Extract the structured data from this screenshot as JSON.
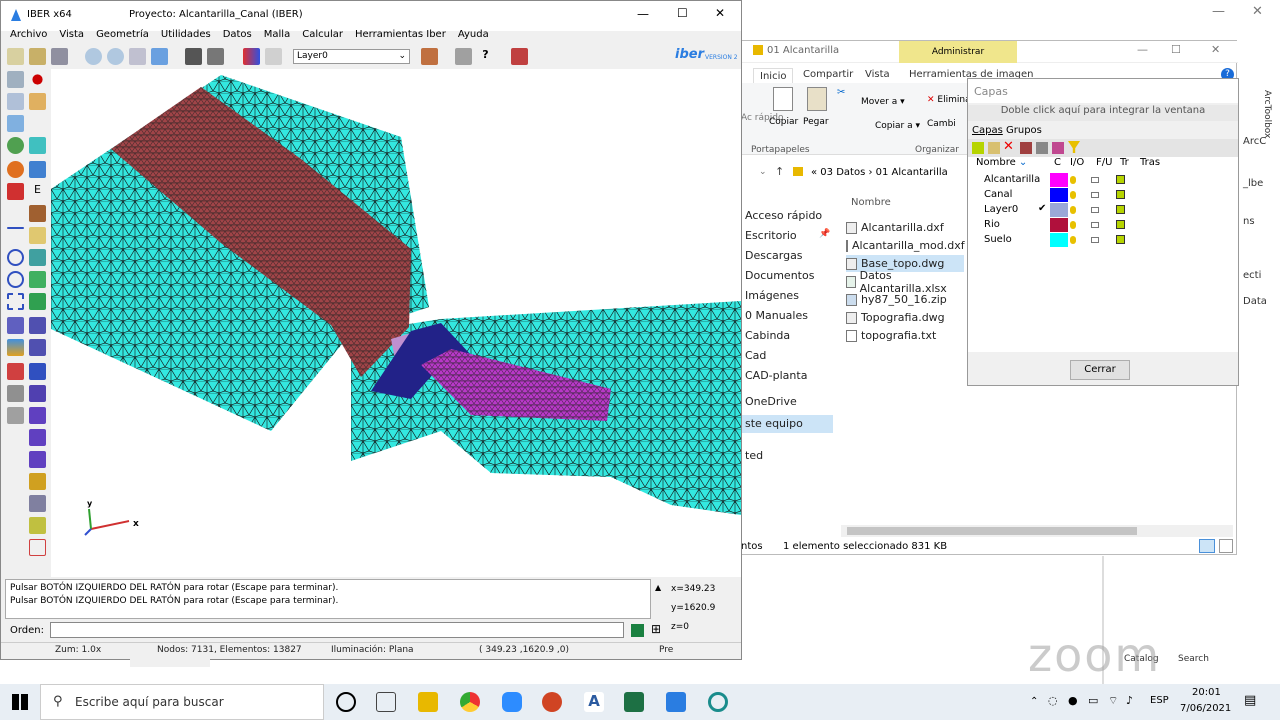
{
  "iber": {
    "title": "IBER x64",
    "project": "Proyecto: Alcantarilla_Canal (IBER)",
    "menu": [
      "Archivo",
      "Vista",
      "Geometría",
      "Utilidades",
      "Datos",
      "Malla",
      "Calcular",
      "Herramientas Iber",
      "Ayuda"
    ],
    "layer_select": "Layer0",
    "brand": "iber",
    "brand_sub": "VERSION 2",
    "console": [
      "Pulsar BOTÓN IZQUIERDO DEL RATÓN para rotar (Escape para terminar).",
      "Pulsar BOTÓN IZQUIERDO DEL RATÓN para rotar (Escape para terminar)."
    ],
    "coords": {
      "x": "x=349.23",
      "y": "y=1620.9",
      "z": "z=0"
    },
    "cmd_label": "Orden:",
    "status": {
      "zoom": "Zum: 1.0x",
      "nodes": "Nodos: 7131, Elementos: 13827",
      "light": "Iluminación: Plana",
      "pos": "( 349.23 ,1620.9 ,0)",
      "pre": "Pre"
    },
    "axes": {
      "x": "x",
      "y": "y"
    },
    "colors": {
      "mesh_cyan": "#33e8e0",
      "mesh_red": "#a04448",
      "mesh_magenta": "#b838c8",
      "mesh_blue": "#222288"
    }
  },
  "explorer": {
    "title": "01 Alcantarilla",
    "admin": "Administrar",
    "tabs": [
      "Inicio",
      "Compartir",
      "Vista",
      "Herramientas de imagen"
    ],
    "ribbon": {
      "copiar": "Copiar",
      "pegar": "Pegar",
      "mover": "Mover a",
      "eliminar": "Elimina",
      "copiar_a": "Copiar a",
      "cambiar": "Cambi",
      "portapapeles": "Portapapeles",
      "organizar": "Organizar",
      "acceso": "Ac rápido"
    },
    "breadcrumb": [
      "03 Datos",
      "01 Alcantarilla"
    ],
    "column": "Nombre",
    "nav": [
      "Acceso rápido",
      "Escritorio",
      "Descargas",
      "Documentos",
      "Imágenes",
      "0 Manuales",
      "Cabinda",
      "Cad",
      "CAD-planta",
      "OneDrive",
      "ste equipo",
      "ted"
    ],
    "files": [
      "Alcantarilla.dxf",
      "Alcantarilla_mod.dxf",
      "Base_topo.dwg",
      "Datos Alcantarilla.xlsx",
      "hy87_50_16.zip",
      "Topografia.dwg",
      "topografia.txt"
    ],
    "status_left": "ntos",
    "status": "1 elemento seleccionado  831 KB"
  },
  "capas": {
    "title": "Capas",
    "hint": "Doble click aquí para integrar la ventana",
    "tabs": [
      "Capas",
      "Grupos"
    ],
    "columns": [
      "Nombre",
      "C",
      "I/O",
      "F/U",
      "Tr",
      "Tras"
    ],
    "layers": [
      {
        "name": "Alcantarilla",
        "color": "#ff00ff",
        "active": false
      },
      {
        "name": "Canal",
        "color": "#0000ff",
        "active": false
      },
      {
        "name": "Layer0",
        "color": "#9ba8d8",
        "active": true
      },
      {
        "name": "Rio",
        "color": "#b0103c",
        "active": false
      },
      {
        "name": "Suelo",
        "color": "#00ffff",
        "active": false
      }
    ],
    "close": "Cerrar"
  },
  "right_fragments": [
    "ArcToolbox",
    "_lbe",
    "ns",
    "ecti",
    "Data",
    "ArcC"
  ],
  "bottom_fragments": {
    "catalog": "Catalog",
    "search": "Search"
  },
  "taskbar": {
    "search": "Escribe aquí para buscar",
    "lang": "ESP",
    "time": "20:01",
    "date": "7/06/2021"
  },
  "watermark": "zoom"
}
